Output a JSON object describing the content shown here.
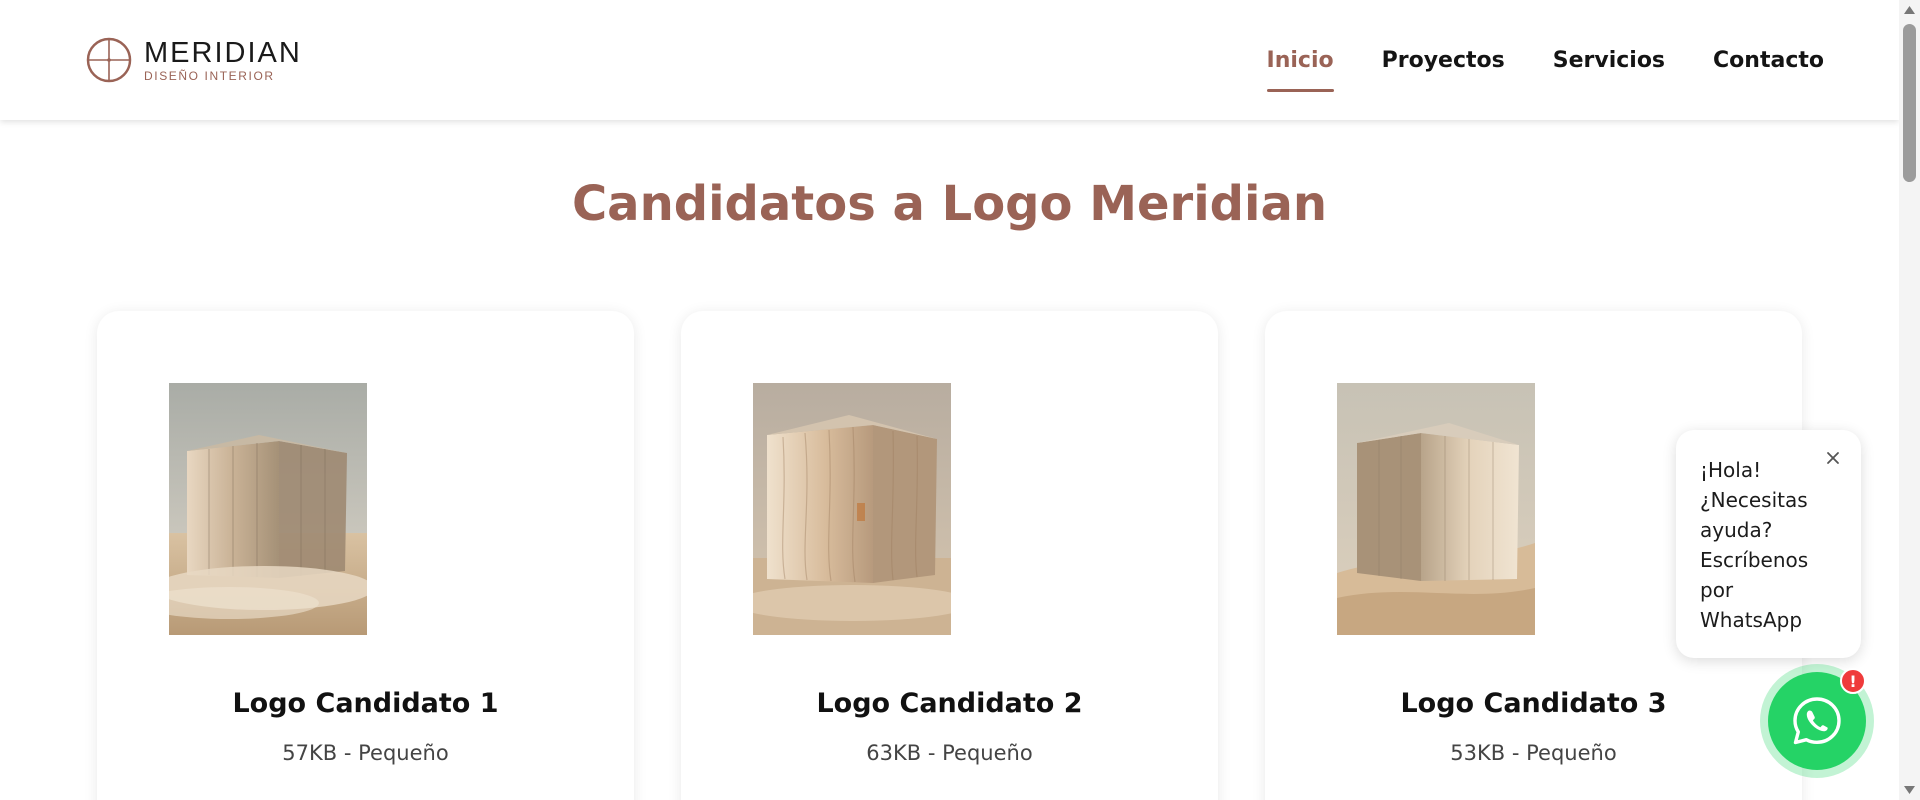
{
  "brand": {
    "name": "MERIDIAN",
    "tagline": "DISEÑO INTERIOR",
    "logo_icon": "crosshair-circle-icon",
    "accent_color": "#9a6356"
  },
  "nav": {
    "items": [
      {
        "label": "Inicio",
        "active": true
      },
      {
        "label": "Proyectos",
        "active": false
      },
      {
        "label": "Servicios",
        "active": false
      },
      {
        "label": "Contacto",
        "active": false
      }
    ]
  },
  "main": {
    "title": "Candidatos a Logo Meridian",
    "cards": [
      {
        "title": "Logo Candidato 1",
        "meta": "57KB - Pequeño",
        "image": "sheer-curtain-cube-in-desert"
      },
      {
        "title": "Logo Candidato 2",
        "meta": "63KB - Pequeño",
        "image": "sheer-curtain-cube-in-desert"
      },
      {
        "title": "Logo Candidato 3",
        "meta": "53KB - Pequeño",
        "image": "sheer-curtain-cube-in-desert"
      }
    ]
  },
  "chat": {
    "message": "¡Hola! ¿Necesitas ayuda? Escríbenos por WhatsApp",
    "close_icon": "close-icon",
    "button_icon": "whatsapp-icon",
    "badge": "!",
    "button_color": "#25d366"
  }
}
